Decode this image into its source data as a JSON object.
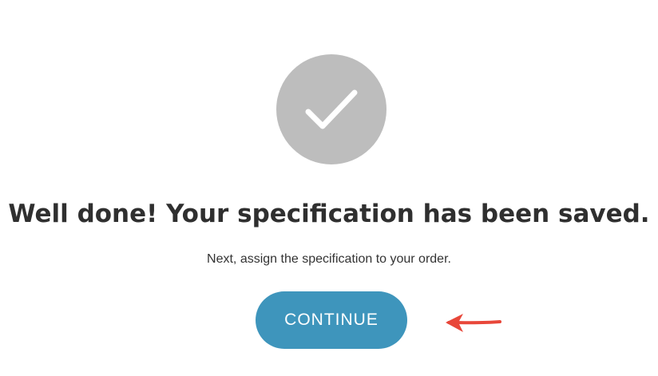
{
  "success": {
    "icon": "checkmark-icon",
    "heading": "Well done! Your specification has been saved.",
    "subtext": "Next, assign the specification to your order."
  },
  "actions": {
    "continue_label": "CONTINUE"
  },
  "annotation": {
    "icon": "arrow-left-icon"
  },
  "colors": {
    "circle": "#bdbdbd",
    "checkmark": "#ffffff",
    "button": "#3e95bc",
    "button_text": "#ffffff",
    "heading": "#2f2f2f",
    "arrow": "#e8473a"
  }
}
